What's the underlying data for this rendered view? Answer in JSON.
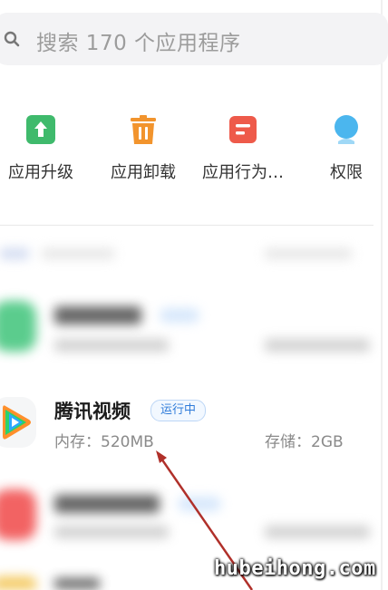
{
  "search": {
    "placeholder": "搜索 170 个应用程序"
  },
  "quick_actions": [
    {
      "label": "应用升级",
      "icon": "upgrade-icon",
      "color": "#3fba6c"
    },
    {
      "label": "应用卸载",
      "icon": "trash-icon",
      "color": "#f2942d"
    },
    {
      "label": "应用行为…",
      "icon": "behavior-icon",
      "color": "#ee5a4a"
    },
    {
      "label": "权限",
      "icon": "permission-icon",
      "color": "#4bb6ee"
    }
  ],
  "apps": [
    {
      "name": "腾讯视频",
      "status": "运行中",
      "memory": "内存：520MB",
      "storage": "存储：2GB"
    }
  ],
  "watermark": "hubeihong.com",
  "colors": {
    "badge_text": "#2f7bd9",
    "arrow": "#b0302a"
  }
}
